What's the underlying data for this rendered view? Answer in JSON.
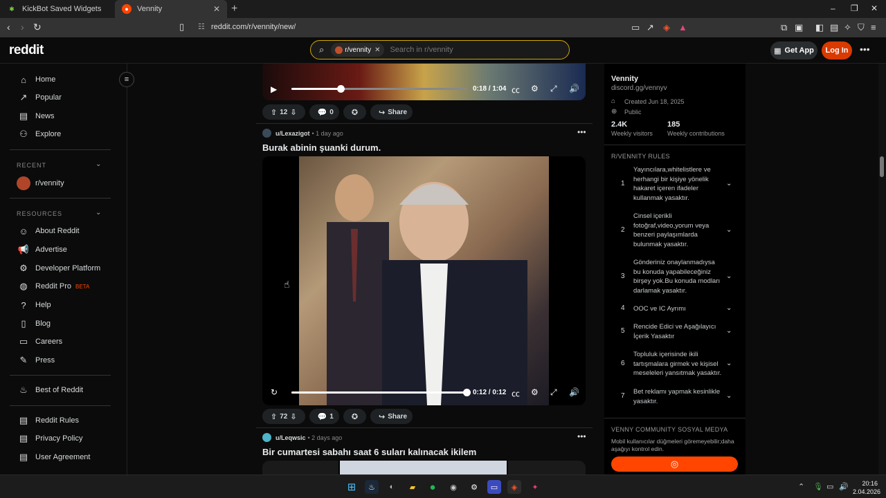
{
  "browser": {
    "tabs": [
      {
        "label": "KickBot Saved Widgets",
        "active": false
      },
      {
        "label": "Vennity",
        "active": true
      }
    ],
    "url": "reddit.com/r/vennity/new/"
  },
  "header": {
    "logo": "reddit",
    "search_chip": "r/vennity",
    "search_placeholder": "Search in r/vennity",
    "get_app": "Get App",
    "login": "Log In"
  },
  "leftnav": {
    "main": [
      "Home",
      "Popular",
      "News",
      "Explore"
    ],
    "recent_heading": "RECENT",
    "recent_item": "r/vennity",
    "resources_heading": "RESOURCES",
    "resources": [
      "About Reddit",
      "Advertise",
      "Developer Platform",
      "Reddit Pro",
      "Help",
      "Blog",
      "Careers",
      "Press"
    ],
    "beta": "BETA",
    "best": "Best of Reddit",
    "legal": [
      "Reddit Rules",
      "Privacy Policy",
      "User Agreement"
    ]
  },
  "posts": [
    {
      "video_time": "0:18 / 1:04",
      "progress": 0.28,
      "votes": "12",
      "comments": "0",
      "share": "Share"
    },
    {
      "user": "u/Lexazigot",
      "age": "1 day ago",
      "title": "Burak abinin şuanki durum.",
      "video_time": "0:12 / 0:12",
      "progress": 1.0,
      "votes": "72",
      "comments": "1",
      "share": "Share"
    },
    {
      "user": "u/Leqwsic",
      "age": "2 days ago",
      "title": "Bir cumartesi sabahı saat 6 suları kalınacak ikilem"
    }
  ],
  "community": {
    "name": "Vennity",
    "link": "discord.gg/vennyv",
    "created": "Created Jun 18, 2025",
    "visibility": "Public",
    "visitors_value": "2.4K",
    "visitors_label": "Weekly visitors",
    "contrib_value": "185",
    "contrib_label": "Weekly contributions",
    "rules_heading": "R/VENNITY RULES",
    "rules": [
      "Yayıncılara,whitelistlere ve herhangi bir kişiye yönelik hakaret içeren ifadeler kullanmak yasaktır.",
      "Cinsel içerikli fotoğraf,video,yorum veya benzeri paylaşımlarda bulunmak yasaktır.",
      "Gönderiniz onaylanmadıysa bu konuda yapabileceğiniz birşey yok.Bu konuda modları darlamak yasaktır.",
      "OOC ve IC Ayrımı",
      "Rencide Edici ve Aşağılayıcı İçerik Yasaktır",
      "Topluluk içerisinde ikili tartışmalara girmek ve kişisel meseleleri yansıtmak yasaktır.",
      "Bet reklamı yapmak kesinlikle yasaktır."
    ],
    "social_heading": "VENNY COMMUNITY SOSYAL MEDYA",
    "social_note": "Mobil kullanıcılar düğmeleri göremeyebilir;daha aşağıyı kontrol edin."
  },
  "taskbar": {
    "time": "20:16",
    "date": "2.04.2026"
  }
}
